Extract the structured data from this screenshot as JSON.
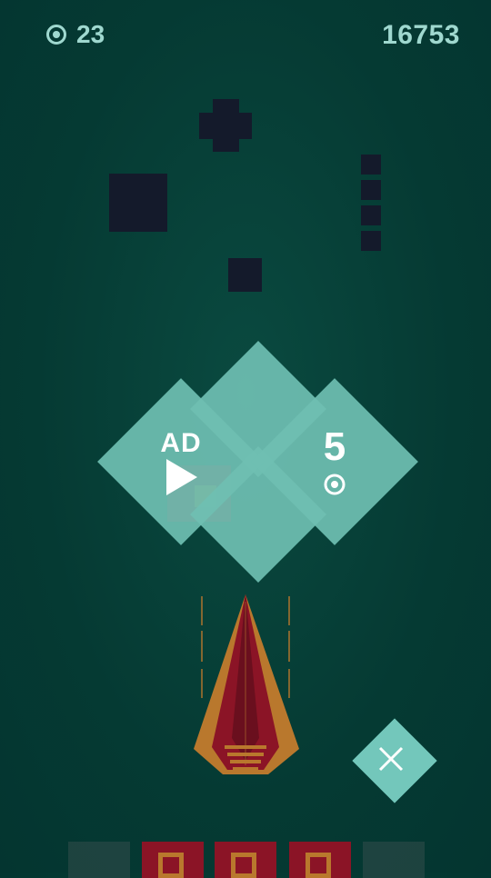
{
  "hud": {
    "coins": "23",
    "score": "16753",
    "coin_icon": "ring-coin-icon"
  },
  "continue_menu": {
    "ad_label": "AD",
    "ad_icon": "play-icon",
    "revive_cost": "5",
    "revive_icon": "ring-coin-icon"
  },
  "close_button": {
    "icon": "close-icon"
  },
  "colors": {
    "background": "#053a33",
    "block": "#141a2b",
    "menu_diamond": "#6fbfb2",
    "ship_body": "#8b1426",
    "ship_wing": "#b9782d",
    "hud_text": "#9fd8cf"
  }
}
